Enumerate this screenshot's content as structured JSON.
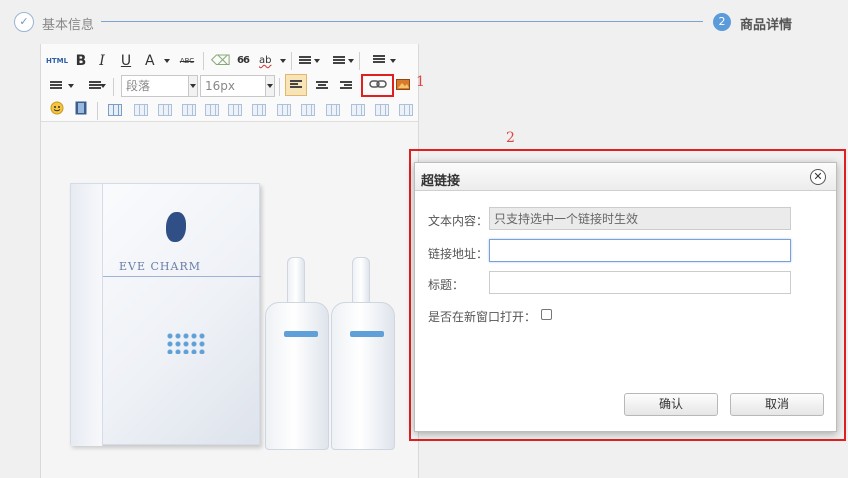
{
  "steps": {
    "step1_icon": "✓",
    "step1_label": "基本信息",
    "step2_number": "2",
    "step2_label": "商品详情"
  },
  "toolbar": {
    "row1": [
      "HTML",
      "B",
      "I",
      "U",
      "A",
      "ABC",
      "66",
      "ab"
    ],
    "paragraph_select": "段落",
    "fontsize_select": "16px"
  },
  "annotations": {
    "marker1": "1",
    "marker2": "2"
  },
  "product": {
    "brand": "EVE CHARM"
  },
  "dialog": {
    "title": "超链接",
    "close_icon": "close-icon",
    "text_label": "文本内容：",
    "text_value": "只支持选中一个链接时生效",
    "url_label": "链接地址：",
    "url_value": "",
    "title_label": "标题：",
    "title_value": "",
    "newwin_label": "是否在新窗口打开：",
    "confirm": "确认",
    "cancel": "取消"
  },
  "colors": {
    "accent": "#5b9bd9",
    "annotation_red": "#e02020"
  }
}
